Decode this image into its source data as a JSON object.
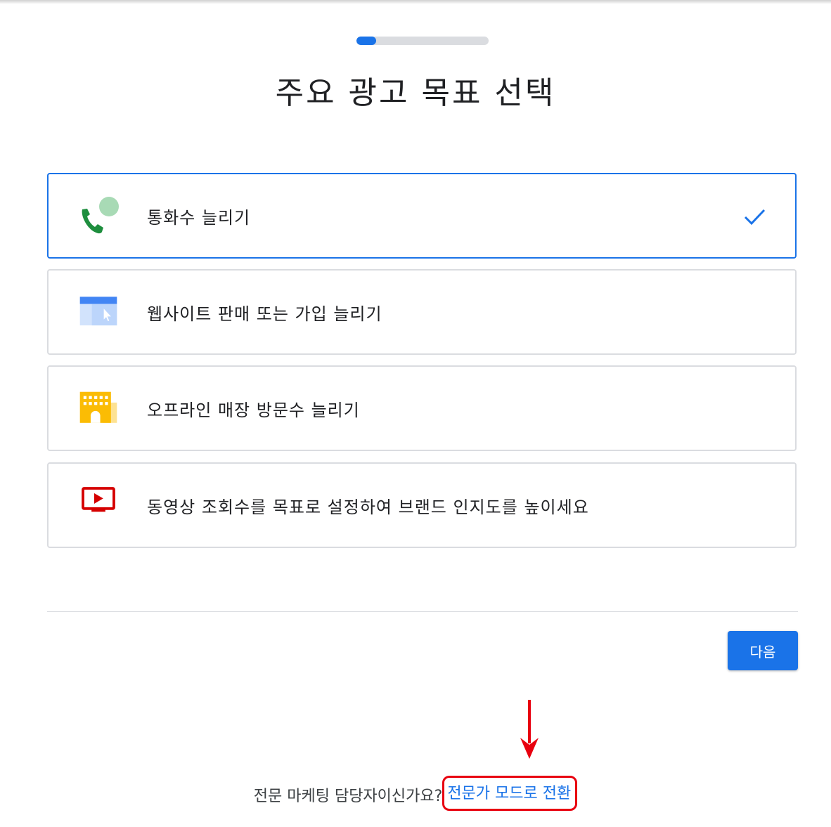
{
  "progress": {
    "fraction": 0.15
  },
  "page_title": "주요 광고 목표 선택",
  "goals": [
    {
      "label": "통화수 늘리기",
      "icon": "phone-call-icon",
      "selected": true
    },
    {
      "label": "웹사이트 판매 또는 가입 늘리기",
      "icon": "website-click-icon",
      "selected": false
    },
    {
      "label": "오프라인 매장 방문수 늘리기",
      "icon": "store-building-icon",
      "selected": false
    },
    {
      "label": "동영상 조회수를 목표로 설정하여 브랜드 인지도를 높이세요",
      "icon": "video-play-icon",
      "selected": false
    }
  ],
  "next_button_label": "다음",
  "footer": {
    "question": "전문 마케팅 담당자이신가요?",
    "expert_link": "전문가 모드로 전환"
  },
  "colors": {
    "accent": "#1a73e8",
    "border": "#dadce0",
    "annotation_red": "#e8000f"
  }
}
